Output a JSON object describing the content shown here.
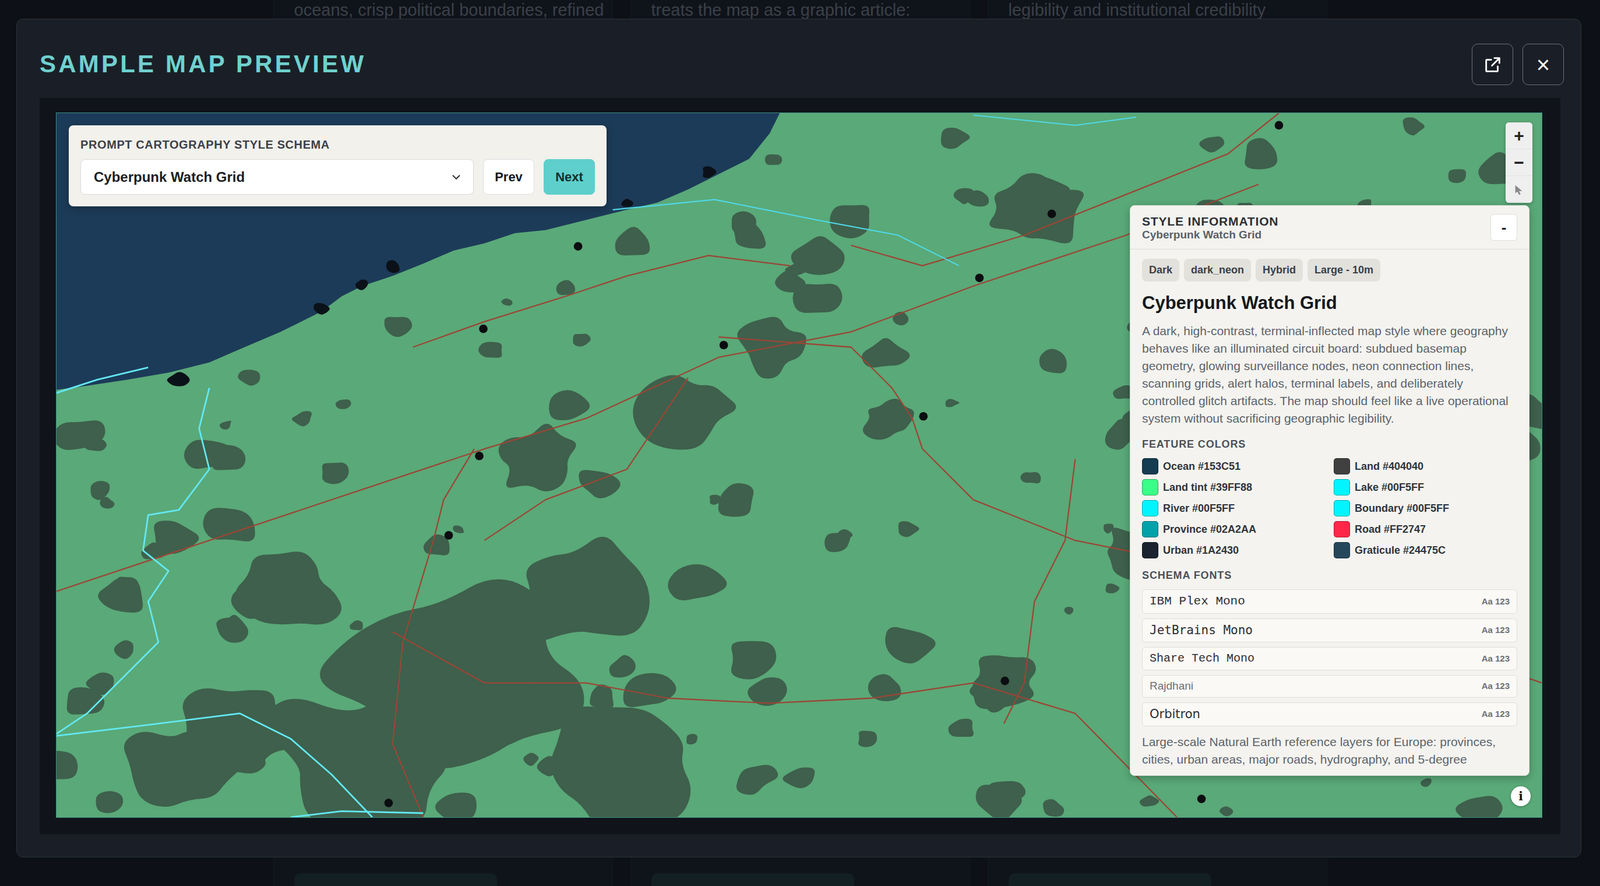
{
  "background_cards": [
    {
      "snippet": "oceans, crisp political boundaries, refined"
    },
    {
      "snippet": "treats the map as a graphic article:"
    },
    {
      "snippet": "legibility and institutional credibility"
    }
  ],
  "modal": {
    "title": "SAMPLE MAP PREVIEW",
    "close": "×"
  },
  "schema_picker": {
    "label": "PROMPT CARTOGRAPHY STYLE SCHEMA",
    "value": "Cyberpunk Watch Grid",
    "buttons": [
      {
        "label": "Prev",
        "primary": false
      },
      {
        "label": "Next",
        "primary": true
      }
    ]
  },
  "zoom": {
    "zoom_in": "+",
    "zoom_out": "−"
  },
  "style_info": {
    "heading": "STYLE INFORMATION",
    "subheading": "Cyberpunk Watch Grid",
    "collapse": "-",
    "tags": [
      "Dark",
      "dark_neon",
      "Hybrid",
      "Large - 10m"
    ],
    "name": "Cyberpunk Watch Grid",
    "description": "A dark, high-contrast, terminal-inflected map style where geography behaves like an illuminated circuit board: subdued basemap geometry, glowing surveillance nodes, neon connection lines, scanning grids, alert halos, terminal labels, and deliberately controlled glitch artifacts. The map should feel like a live operational system without sacrificing geographic legibility.",
    "colors_heading": "FEATURE COLORS",
    "colors": [
      {
        "label": "Ocean #153C51",
        "color": "#153C51"
      },
      {
        "label": "Land #404040",
        "color": "#404040"
      },
      {
        "label": "Land tint #39FF88",
        "color": "#39FF88"
      },
      {
        "label": "Lake #00F5FF",
        "color": "#00F5FF"
      },
      {
        "label": "River #00F5FF",
        "color": "#00F5FF"
      },
      {
        "label": "Boundary #00F5FF",
        "color": "#00F5FF"
      },
      {
        "label": "Province #02A2AA",
        "color": "#02A2AA"
      },
      {
        "label": "Road #FF2747",
        "color": "#FF2747"
      },
      {
        "label": "Urban #1A2430",
        "color": "#1A2430"
      },
      {
        "label": "Graticule #24475C",
        "color": "#24475C"
      }
    ],
    "fonts_heading": "SCHEMA FONTS",
    "fonts": [
      {
        "name": "IBM Plex Mono",
        "sample": "Aa 123"
      },
      {
        "name": "JetBrains Mono",
        "sample": "Aa 123"
      },
      {
        "name": "Share Tech Mono",
        "sample": "Aa 123"
      },
      {
        "name": "Rajdhani",
        "sample": "Aa 123"
      },
      {
        "name": "Orbitron",
        "sample": "Aa 123"
      }
    ],
    "footer": "Large-scale Natural Earth reference layers for Europe: provinces, cities, urban areas, major roads, hydrography, and 5-degree"
  },
  "info_button": "i"
}
